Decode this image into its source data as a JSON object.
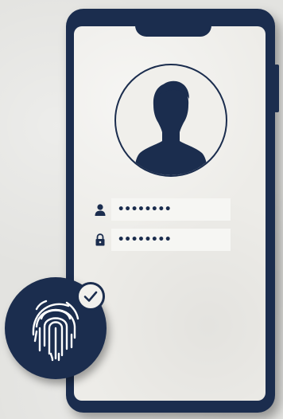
{
  "login": {
    "username_value": "••••••••",
    "password_value": "••••••••"
  },
  "icons": {
    "avatar": "user-silhouette-icon",
    "username": "user-icon",
    "password": "lock-icon",
    "fingerprint": "fingerprint-icon",
    "verified": "check-icon"
  },
  "colors": {
    "primary": "#1b2d4e",
    "screen": "#edece8",
    "background": "#e3e3e0"
  }
}
